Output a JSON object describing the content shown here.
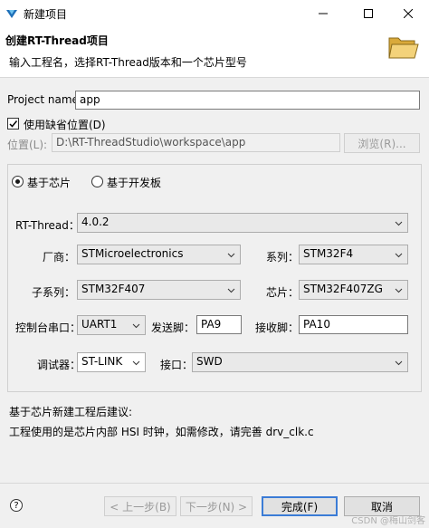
{
  "window": {
    "title": "新建项目"
  },
  "header": {
    "title": "创建RT-Thread项目",
    "description": "输入工程名，选择RT-Thread版本和一个芯片型号",
    "icon": "folder-icon"
  },
  "project": {
    "name_label": "Project name:",
    "name_value": "app",
    "use_default_label": "使用缺省位置(D)",
    "use_default_checked": true,
    "location_label": "位置(L):",
    "location_value": "D:\\RT-ThreadStudio\\workspace\\app",
    "browse_label": "浏览(R)..."
  },
  "source": {
    "chip_label": "基于芯片",
    "board_label": "基于开发板",
    "selected": "chip"
  },
  "config": {
    "rtthread_label": "RT-Thread：",
    "rtthread_value": "4.0.2",
    "vendor_label": "厂商：",
    "vendor_value": "STMicroelectronics",
    "series_label": "系列：",
    "series_value": "STM32F4",
    "subseries_label": "子系列：",
    "subseries_value": "STM32F407",
    "chip_label": "芯片：",
    "chip_value": "STM32F407ZG",
    "console_label": "控制台串口：",
    "console_value": "UART1",
    "tx_label": "发送脚：",
    "tx_value": "PA9",
    "rx_label": "接收脚：",
    "rx_value": "PA10",
    "debugger_label": "调试器：",
    "debugger_value": "ST-LINK",
    "interface_label": "接口：",
    "interface_value": "SWD"
  },
  "advice": {
    "title": "基于芯片新建工程后建议:",
    "text": "工程使用的是芯片内部 HSI 时钟，如需修改，请完善 drv_clk.c"
  },
  "footer": {
    "back_label": "< 上一步(B)",
    "next_label": "下一步(N) >",
    "finish_label": "完成(F)",
    "cancel_label": "取消",
    "watermark": "CSDN @梅山剑客"
  }
}
